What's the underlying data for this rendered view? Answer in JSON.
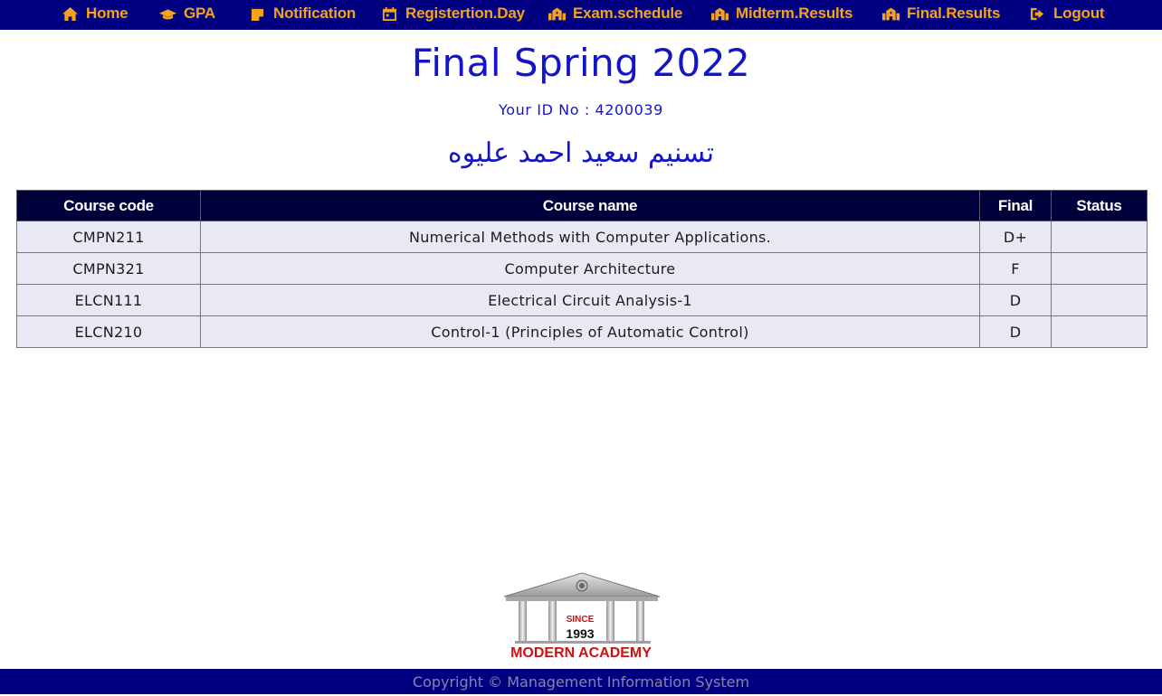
{
  "nav": {
    "items": [
      {
        "label": "Home",
        "icon": "home-icon"
      },
      {
        "label": "GPA",
        "icon": "graduation-cap-icon"
      },
      {
        "label": "Notification",
        "icon": "sticky-note-icon"
      },
      {
        "label": "Registertion.Day",
        "icon": "calendar-icon"
      },
      {
        "label": "Exam.schedule",
        "icon": "school-building-icon"
      },
      {
        "label": "Midterm.Results",
        "icon": "school-building-icon"
      },
      {
        "label": "Final.Results",
        "icon": "school-building-icon"
      },
      {
        "label": "Logout",
        "icon": "logout-icon"
      }
    ],
    "colors": {
      "background": "#000080",
      "text": "#f7a21b"
    }
  },
  "page": {
    "title": "Final Spring 2022",
    "student_id": "Your ID No : 4200039",
    "student_name": "تسنيم سعيد احمد عليوه"
  },
  "table": {
    "headers": [
      "Course code",
      "Course name",
      "Final",
      "Status"
    ],
    "rows": [
      {
        "code": "CMPN211",
        "name": "Numerical Methods with Computer Applications.",
        "final": "D+",
        "status": ""
      },
      {
        "code": "CMPN321",
        "name": "Computer Architecture",
        "final": "F",
        "status": ""
      },
      {
        "code": "ELCN111",
        "name": "Electrical Circuit Analysis-1",
        "final": "D",
        "status": ""
      },
      {
        "code": "ELCN210",
        "name": "Control-1 (Principles of Automatic Control)",
        "final": "D",
        "status": ""
      }
    ]
  },
  "logo": {
    "since": "SINCE",
    "year": "1993",
    "name": "MODERN ACADEMY"
  },
  "footer": {
    "copyright": "Copyright © Management Information System"
  }
}
